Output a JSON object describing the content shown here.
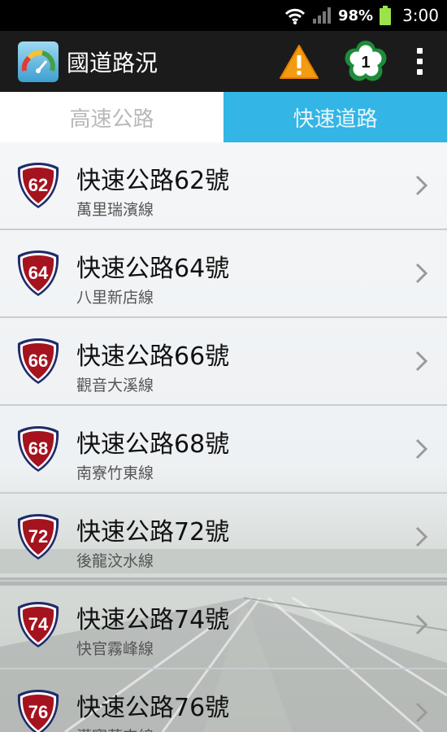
{
  "status_bar": {
    "battery_percent": "98%",
    "time": "3:00",
    "icons": [
      "wifi-icon",
      "signal-icon",
      "battery-icon"
    ]
  },
  "action_bar": {
    "title": "國道路況",
    "icons": [
      "speedometer-app-icon",
      "warning-icon",
      "flower-badge-icon",
      "overflow-menu-icon"
    ],
    "badge_number": "1"
  },
  "tabs": [
    {
      "label": "高速公路",
      "selected": false
    },
    {
      "label": "快速道路",
      "selected": true
    }
  ],
  "colors": {
    "tab_active": "#33b5e5",
    "shield_red": "#a5131f",
    "shield_navy": "#1f2b6b",
    "warning_orange": "#f39c12",
    "badge_green": "#1e8c3a"
  },
  "routes": [
    {
      "number": "62",
      "title": "快速公路62號",
      "subtitle": "萬里瑞濱線"
    },
    {
      "number": "64",
      "title": "快速公路64號",
      "subtitle": "八里新店線"
    },
    {
      "number": "66",
      "title": "快速公路66號",
      "subtitle": "觀音大溪線"
    },
    {
      "number": "68",
      "title": "快速公路68號",
      "subtitle": "南寮竹東線"
    },
    {
      "number": "72",
      "title": "快速公路72號",
      "subtitle": "後龍汶水線"
    },
    {
      "number": "74",
      "title": "快速公路74號",
      "subtitle": "快官霧峰線"
    },
    {
      "number": "76",
      "title": "快速公路76號",
      "subtitle": "漢寶草屯線"
    }
  ]
}
